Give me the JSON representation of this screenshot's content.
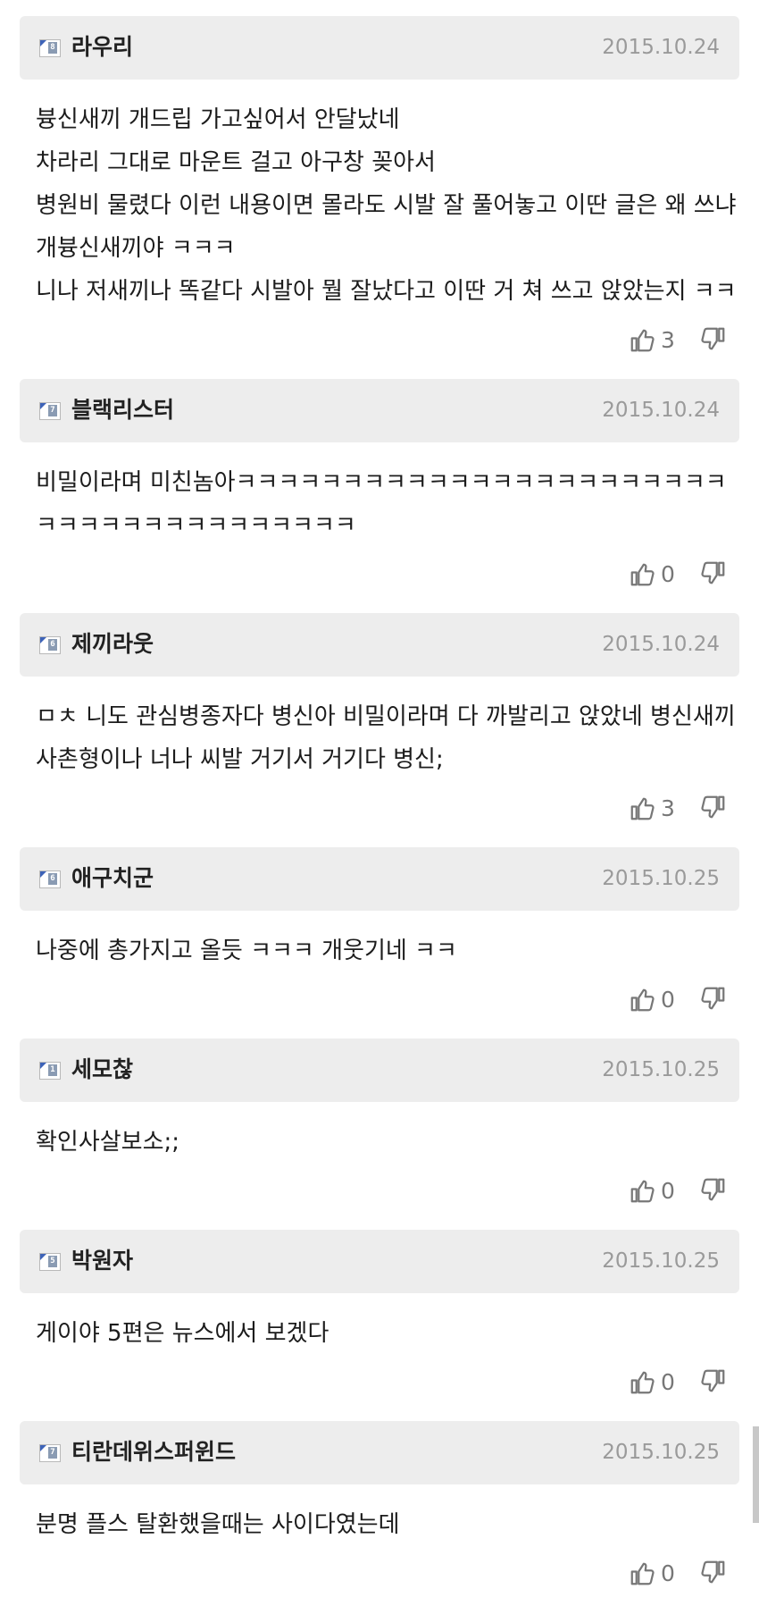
{
  "comments": [
    {
      "user": "라우리",
      "level": "8",
      "date": "2015.10.24",
      "text": "븅신새끼 개드립 가고싶어서 안달났네\n차라리 그대로 마운트 걸고 아구창 꽂아서\n병원비 물렸다 이런 내용이면 몰라도 시발 잘 풀어놓고 이딴 글은 왜 쓰냐 개븅신새끼야 ㅋㅋㅋ\n니나 저새끼나 똑같다 시발아 뭘 잘났다고 이딴 거 쳐 쓰고 앉았는지 ㅋㅋ",
      "likes": "3"
    },
    {
      "user": "블랙리스터",
      "level": "7",
      "date": "2015.10.24",
      "text": "비밀이라며 미친놈아ㅋㅋㅋㅋㅋㅋㅋㅋㅋㅋㅋㅋㅋㅋㅋㅋㅋㅋㅋㅋㅋㅋㅋㅋㅋㅋㅋㅋㅋㅋㅋㅋㅋㅋㅋㅋㅋㅋ",
      "likes": "0"
    },
    {
      "user": "제끼라웃",
      "level": "6",
      "date": "2015.10.24",
      "text": "ㅁㅊ 니도 관심병종자다 병신아 비밀이라며 다 까발리고 앉았네 병신새끼 사촌형이나 너나 씨발 거기서 거기다 병신;",
      "likes": "3"
    },
    {
      "user": "애구치군",
      "level": "6",
      "date": "2015.10.25",
      "text": "나중에 총가지고 올듯 ㅋㅋㅋ 개웃기네 ㅋㅋ",
      "likes": "0"
    },
    {
      "user": "세모찮",
      "level": "1",
      "date": "2015.10.25",
      "text": "확인사살보소;;",
      "likes": "0"
    },
    {
      "user": "박원자",
      "level": "5",
      "date": "2015.10.25",
      "text": "게이야 5편은 뉴스에서 보겠다",
      "likes": "0"
    },
    {
      "user": "티란데위스퍼윈드",
      "level": "7",
      "date": "2015.10.25",
      "text": "분명 플스 탈환했을때는 사이다였는데",
      "likes": "0"
    }
  ],
  "icons": {
    "like": "thumbs-up-icon",
    "dislike": "thumbs-down-icon",
    "level": "level-badge-icon"
  },
  "colors": {
    "header_bg": "#ededed",
    "date": "#9a9a9a",
    "vote": "#777777",
    "badge_accent": "#3d63b8"
  }
}
